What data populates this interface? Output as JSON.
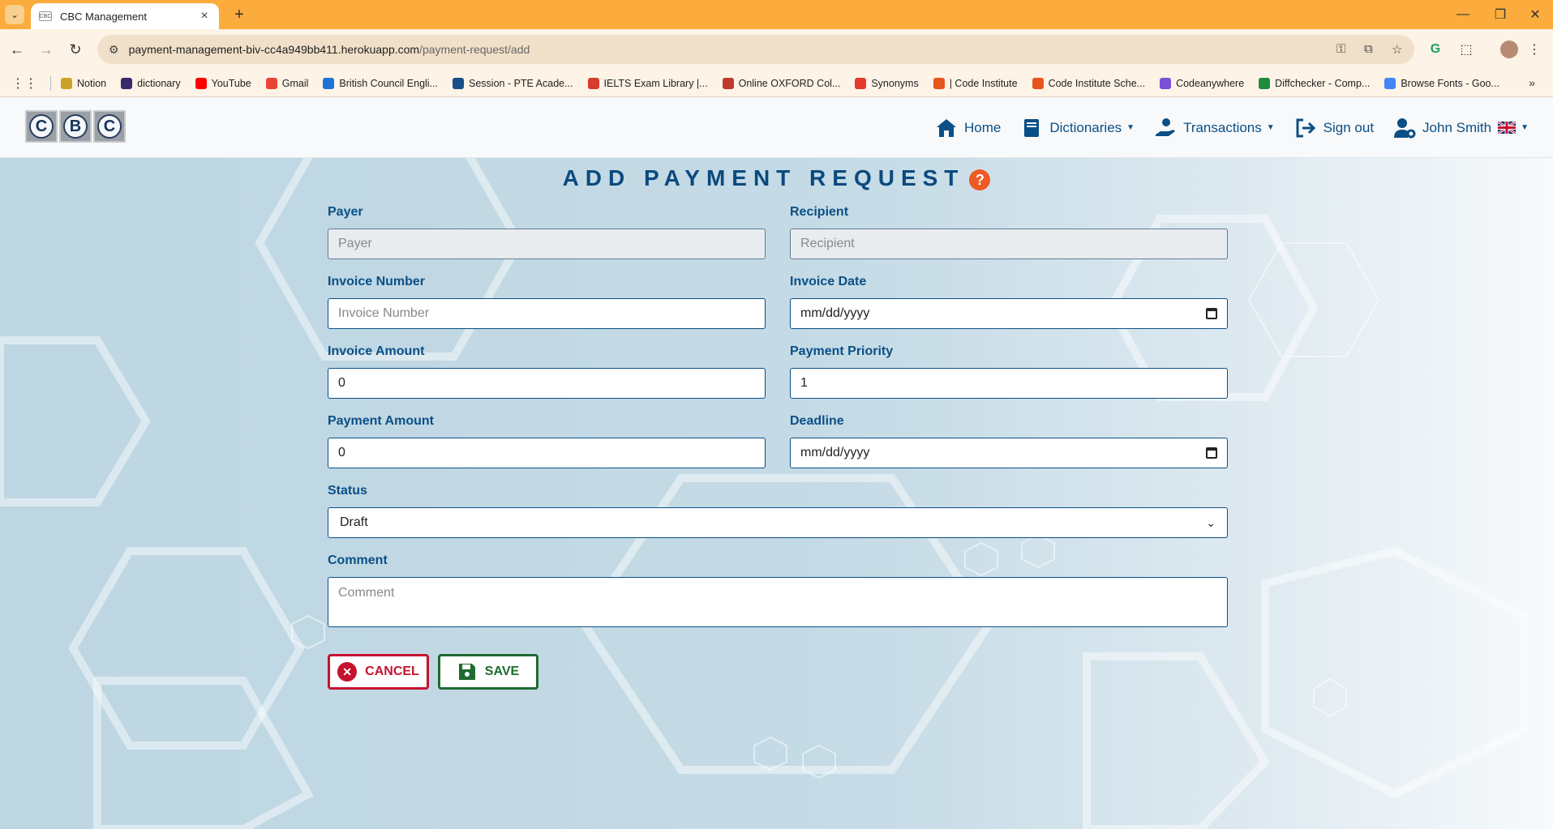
{
  "browser": {
    "tab_title": "CBC Management",
    "url_host": "payment-management-biv-cc4a949bb411.herokuapp.com",
    "url_path": "/payment-request/add",
    "bookmarks": [
      {
        "label": "Notion",
        "color": "#c9a227"
      },
      {
        "label": "dictionary",
        "color": "#3b2a6b"
      },
      {
        "label": "YouTube",
        "color": "#ff0000"
      },
      {
        "label": "Gmail",
        "color": "#ea4335"
      },
      {
        "label": "British Council Engli...",
        "color": "#1e73d8"
      },
      {
        "label": "Session - PTE Acade...",
        "color": "#1a4f8a"
      },
      {
        "label": "IELTS Exam Library |...",
        "color": "#d63b2f"
      },
      {
        "label": "Online OXFORD Col...",
        "color": "#c0392b"
      },
      {
        "label": "Synonyms",
        "color": "#e23b2e"
      },
      {
        "label": "| Code Institute",
        "color": "#e8541e"
      },
      {
        "label": "Code Institute Sche...",
        "color": "#e8541e"
      },
      {
        "label": "Codeanywhere",
        "color": "#7b4fd6"
      },
      {
        "label": "Diffchecker - Comp...",
        "color": "#1c8c3f"
      },
      {
        "label": "Browse Fonts - Goo...",
        "color": "#4285f4"
      }
    ]
  },
  "navbar": {
    "logo_letters": [
      "C",
      "B",
      "C"
    ],
    "home": "Home",
    "dictionaries": "Dictionaries",
    "transactions": "Transactions",
    "sign_out": "Sign out",
    "user": "John Smith"
  },
  "form": {
    "title": "ADD PAYMENT REQUEST",
    "help": "?",
    "payer": {
      "label": "Payer",
      "placeholder": "Payer"
    },
    "recipient": {
      "label": "Recipient",
      "placeholder": "Recipient"
    },
    "invoice_number": {
      "label": "Invoice Number",
      "placeholder": "Invoice Number"
    },
    "invoice_date": {
      "label": "Invoice Date",
      "value": "mm/dd/yyyy"
    },
    "invoice_amount": {
      "label": "Invoice Amount",
      "value": "0"
    },
    "payment_priority": {
      "label": "Payment Priority",
      "value": "1"
    },
    "payment_amount": {
      "label": "Payment Amount",
      "value": "0"
    },
    "deadline": {
      "label": "Deadline",
      "value": "mm/dd/yyyy"
    },
    "status": {
      "label": "Status",
      "value": "Draft"
    },
    "comment": {
      "label": "Comment",
      "placeholder": "Comment"
    },
    "cancel": "CANCEL",
    "save": "SAVE"
  }
}
